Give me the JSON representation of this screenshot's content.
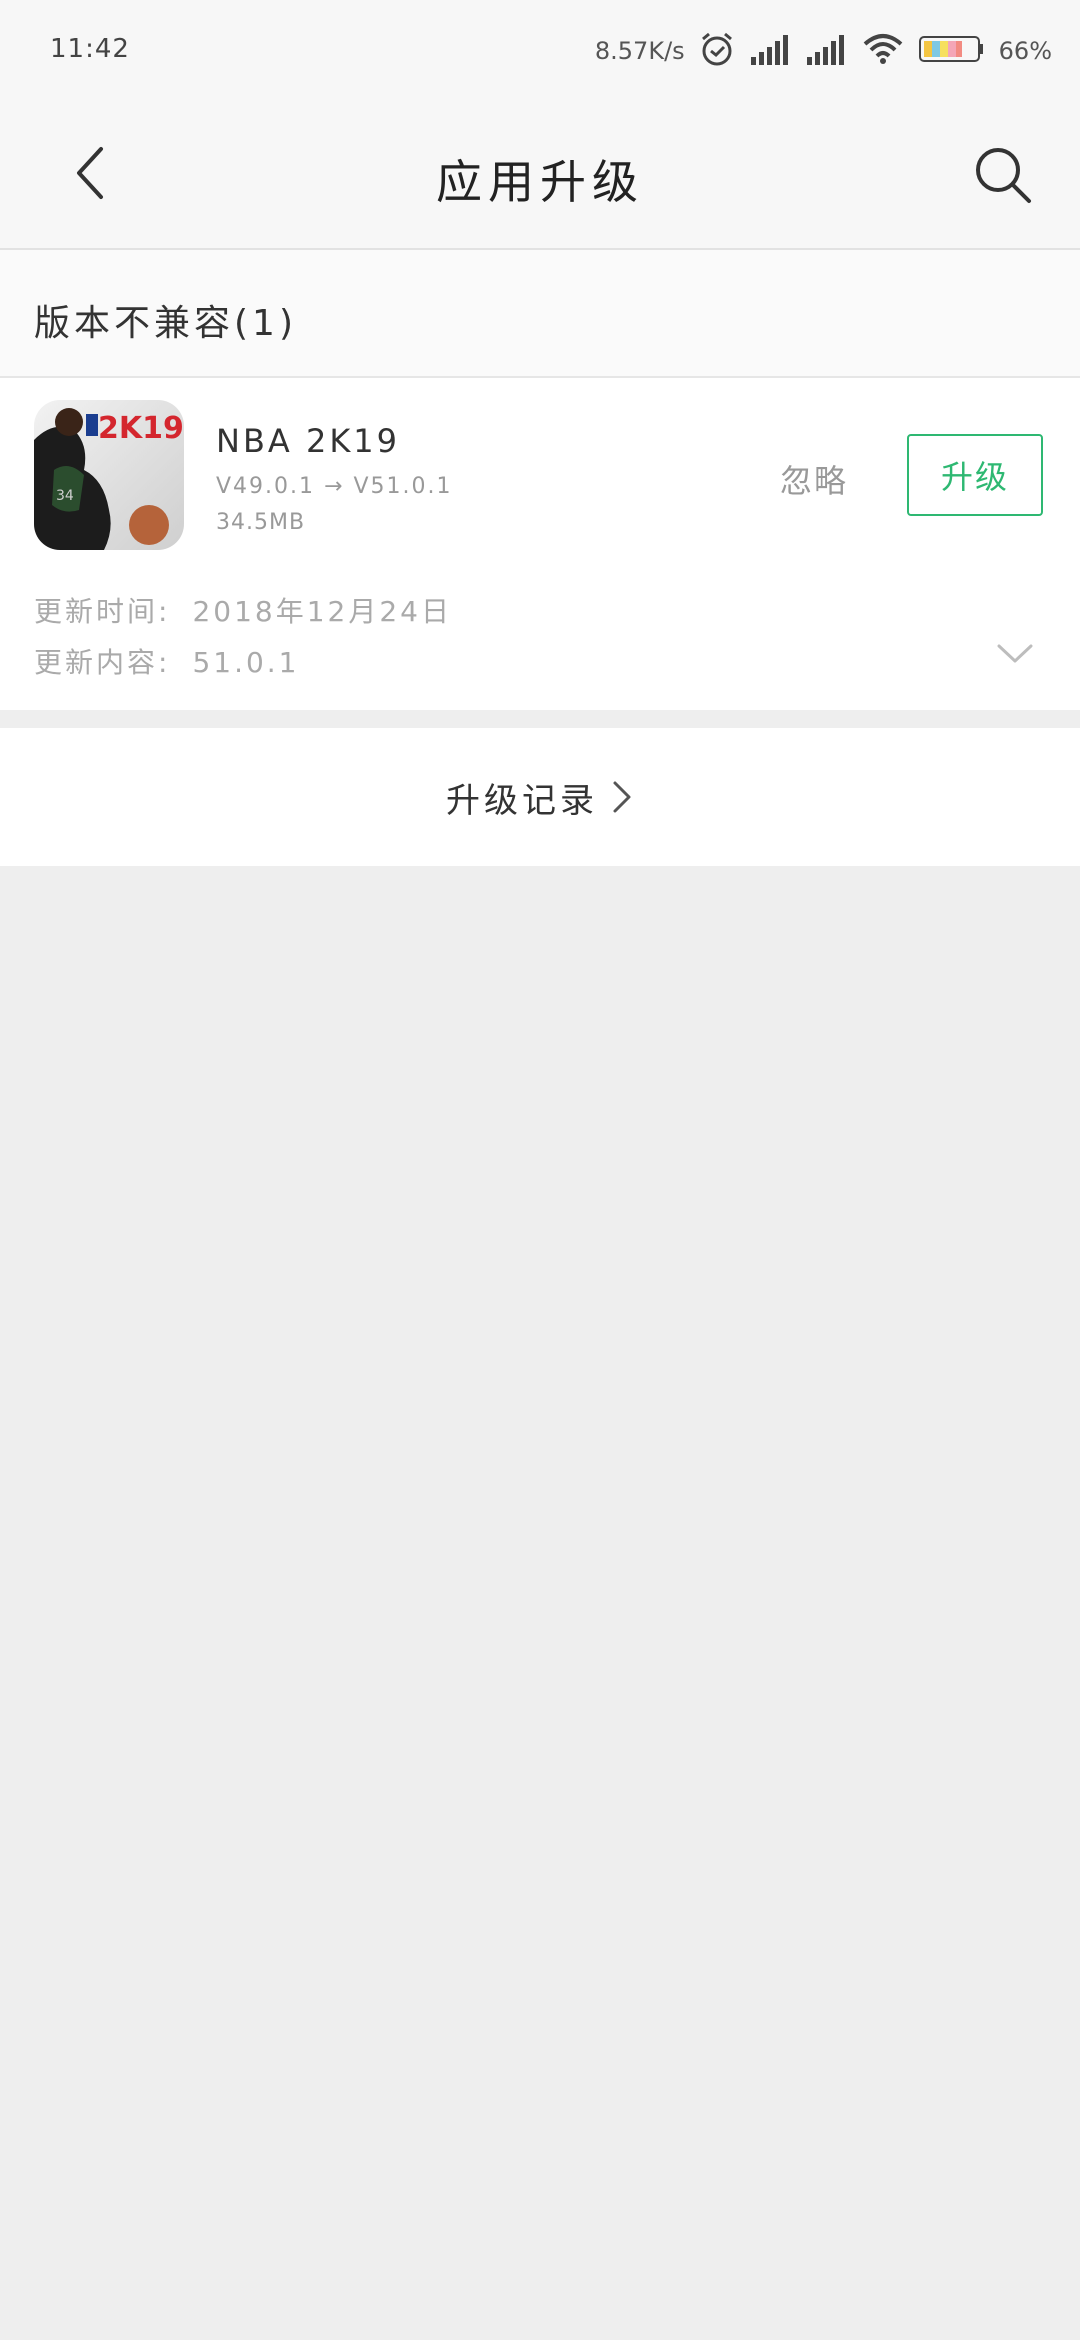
{
  "status_bar": {
    "time": "11:42",
    "net_speed": "8.57K/s",
    "battery": "66%"
  },
  "header": {
    "title": "应用升级"
  },
  "section": {
    "title": "版本不兼容(1)"
  },
  "app": {
    "name": "NBA 2K19",
    "version": "V49.0.1 → V51.0.1",
    "size": "34.5MB",
    "ignore_label": "忽略",
    "upgrade_label": "升级",
    "icon": "nba-2k19-app-icon",
    "update_time_label": "更新时间:",
    "update_time_value": "2018年12月24日",
    "update_content_label": "更新内容:",
    "update_content_value": "51.0.1"
  },
  "history": {
    "label": "升级记录"
  },
  "colors": {
    "accent": "#2eb872",
    "background": "#eeeeee",
    "muted_text": "#999999"
  }
}
